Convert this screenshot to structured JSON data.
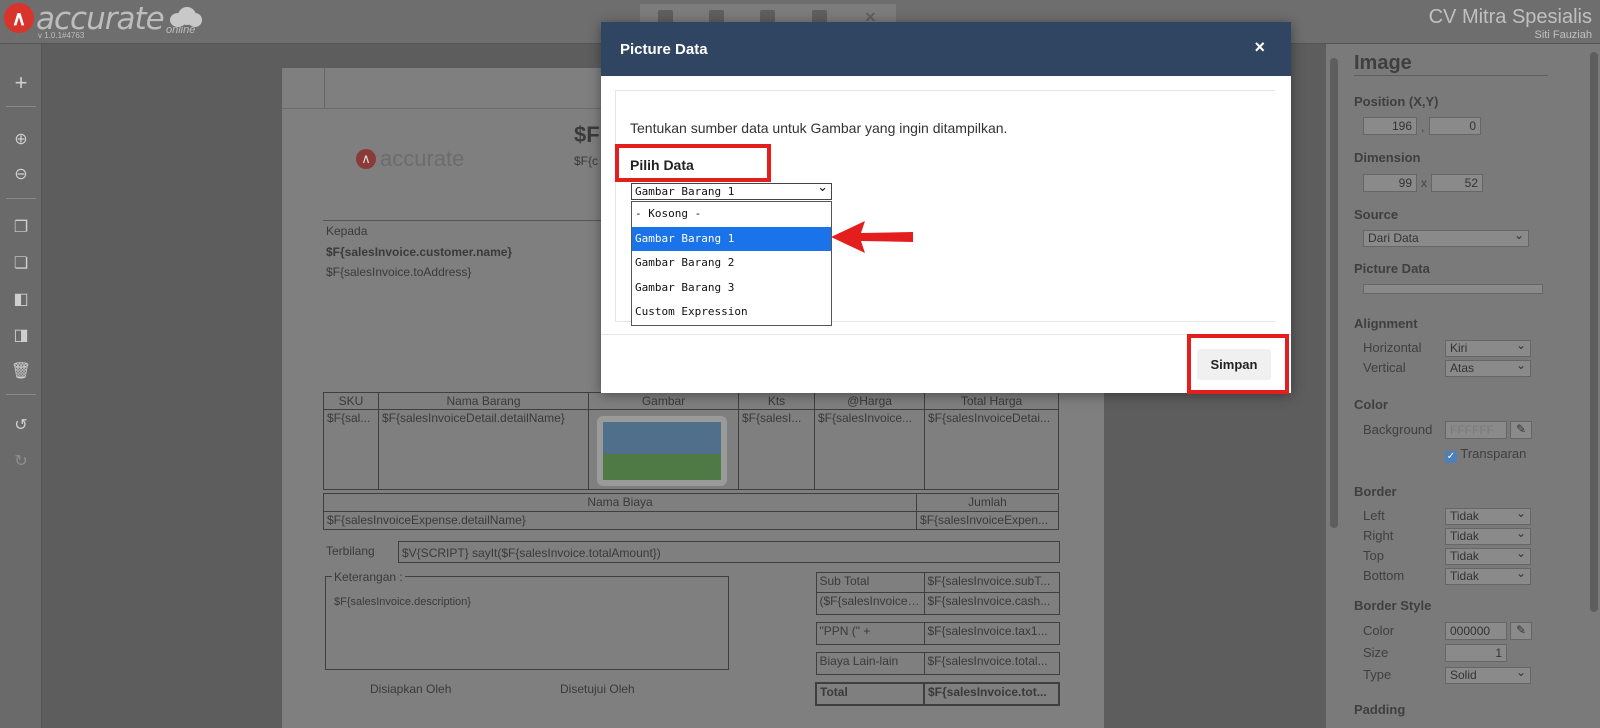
{
  "app": {
    "logo_text": "accurate",
    "logo_sub": "online",
    "version": "v 1.0.1#4763",
    "company": "CV Mitra Spesialis",
    "user": "Siti Fauziah"
  },
  "document": {
    "title_partial": "$F",
    "subtitle_partial": "$F{c",
    "logo_text": "accurate",
    "kepada_label": "Kepada",
    "customer_name": "$F{salesInvoice.customer.name}",
    "to_address": "$F{salesInvoice.toAddress}",
    "items_table": {
      "headers": [
        "SKU",
        "Nama Barang",
        "Gambar",
        "Kts",
        "@Harga",
        "Total Harga"
      ],
      "row": [
        "$F{sal...",
        "$F{salesInvoiceDetail.detailName}",
        "",
        "$F{salesI...",
        "$F{salesInvoice...",
        "$F{salesInvoiceDetai..."
      ]
    },
    "expense_table": {
      "headers": [
        "Nama Biaya",
        "Jumlah"
      ],
      "row": [
        "$F{salesInvoiceExpense.detailName}",
        "$F{salesInvoiceExpen..."
      ]
    },
    "terbilang_label": "Terbilang",
    "terbilang_value": "$V{SCRIPT} sayIt($F{salesInvoice.totalAmount})",
    "keterangan_label": "Keterangan :",
    "description": "$F{salesInvoice.description}",
    "summary": [
      [
        "Sub Total",
        "$F{salesInvoice.subT..."
      ],
      [
        "($F{salesInvoice....",
        "$F{salesInvoice.cash..."
      ],
      [
        "\"PPN (\" +",
        "$F{salesInvoice.tax1..."
      ],
      [
        "Biaya Lain-lain",
        "$F{salesInvoice.total..."
      ],
      [
        "Total",
        "$F{salesInvoice.tot..."
      ]
    ],
    "prepared_by": "Disiapkan Oleh",
    "approved_by": "Disetujui Oleh"
  },
  "right_panel": {
    "title": "Image",
    "position_label": "Position (X,Y)",
    "position_x": "196",
    "position_y": "0",
    "position_sep": ",",
    "dimension_label": "Dimension",
    "dim_w": "99",
    "dim_h": "52",
    "dim_sep": "x",
    "source_label": "Source",
    "source_value": "Dari Data",
    "picture_data_label": "Picture Data",
    "alignment_label": "Alignment",
    "horizontal_label": "Horizontal",
    "horizontal_value": "Kiri",
    "vertical_label": "Vertical",
    "vertical_value": "Atas",
    "color_label": "Color",
    "background_label": "Background",
    "background_value": "FFFFFF",
    "transparan_label": "Transparan",
    "border_label": "Border",
    "left_label": "Left",
    "right_label": "Right",
    "top_label": "Top",
    "bottom_label": "Bottom",
    "border_value": "Tidak",
    "border_style_label": "Border Style",
    "bs_color_label": "Color",
    "bs_color_value": "000000",
    "bs_size_label": "Size",
    "bs_size_value": "1",
    "bs_type_label": "Type",
    "bs_type_value": "Solid",
    "padding_label": "Padding"
  },
  "modal": {
    "title": "Picture Data",
    "close": "×",
    "description": "Tentukan sumber data untuk Gambar yang ingin ditampilkan.",
    "pilih_label": "Pilih Data",
    "selected": "Gambar Barang 1",
    "options": [
      "- Kosong -",
      "Gambar Barang 1",
      "Gambar Barang 2",
      "Gambar Barang 3",
      "Custom Expression"
    ],
    "save_label": "Simpan"
  },
  "colors": {
    "modal_header": "#2f4562",
    "highlight_red": "#e41d1d",
    "selected_option": "#1a73e8"
  }
}
